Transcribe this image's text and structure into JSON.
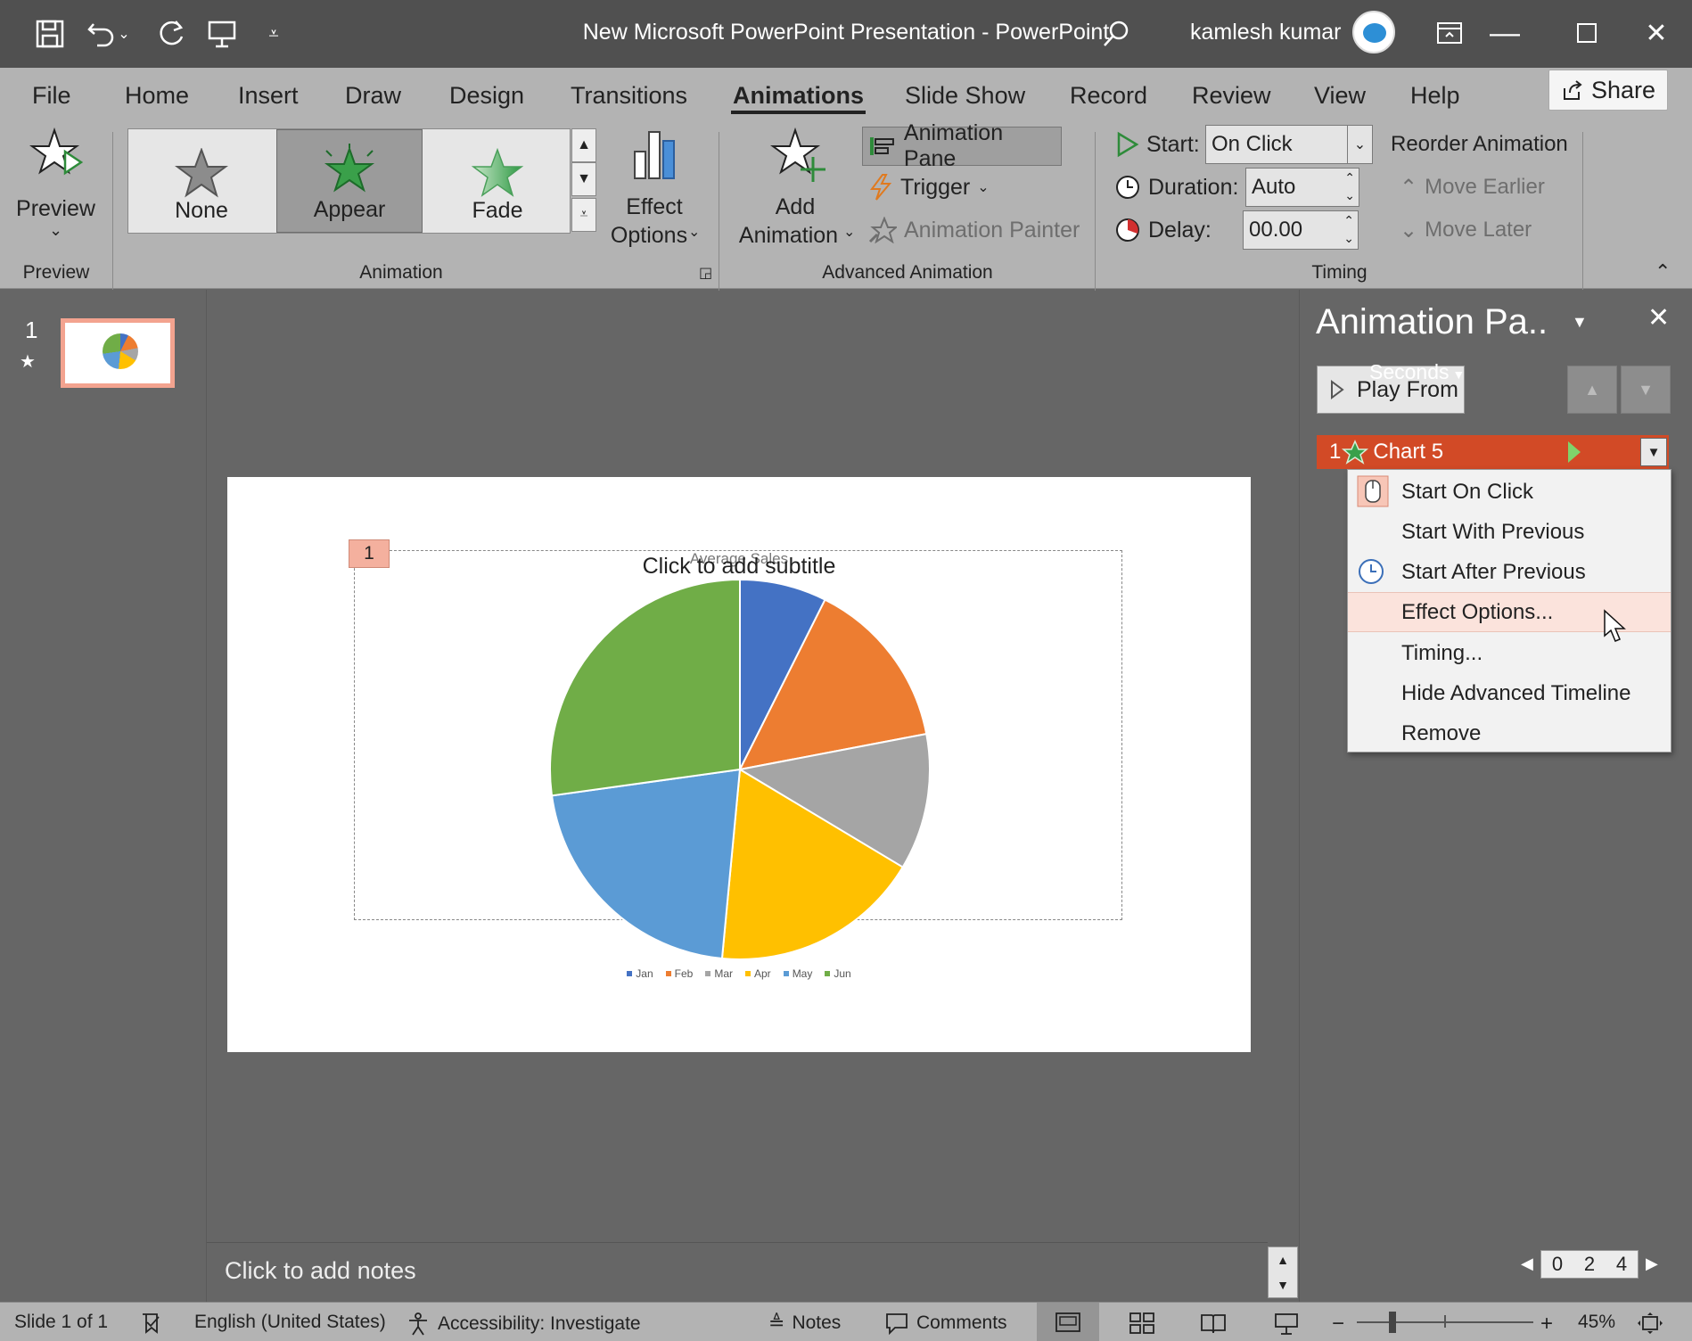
{
  "window": {
    "title": "New Microsoft PowerPoint Presentation  -  PowerPoint",
    "user": "kamlesh kumar"
  },
  "tabs": [
    "File",
    "Home",
    "Insert",
    "Draw",
    "Design",
    "Transitions",
    "Animations",
    "Slide Show",
    "Record",
    "Review",
    "View",
    "Help"
  ],
  "active_tab": "Animations",
  "share_label": "Share",
  "ribbon": {
    "preview": {
      "label": "Preview",
      "group": "Preview"
    },
    "animation_group": "Animation",
    "gallery": [
      "None",
      "Appear",
      "Fade"
    ],
    "gallery_selected": "Appear",
    "effect_options": {
      "line1": "Effect",
      "line2": "Options"
    },
    "advanced": {
      "group": "Advanced Animation",
      "add_line1": "Add",
      "add_line2": "Animation",
      "animation_pane": "Animation Pane",
      "trigger": "Trigger",
      "animation_painter": "Animation Painter"
    },
    "timing": {
      "group": "Timing",
      "start_label": "Start:",
      "start_value": "On Click",
      "duration_label": "Duration:",
      "duration_value": "Auto",
      "delay_label": "Delay:",
      "delay_value": "00.00",
      "reorder": "Reorder Animation",
      "move_earlier": "Move Earlier",
      "move_later": "Move Later"
    }
  },
  "thumbnails": {
    "number": "1"
  },
  "slide": {
    "anim_tag": "1",
    "chart_title": "Average Sales",
    "subtitle_placeholder": "Click to add subtitle"
  },
  "chart_data": {
    "type": "pie",
    "title": "Average Sales",
    "categories": [
      "Jan",
      "Feb",
      "Mar",
      "Apr",
      "May",
      "Jun"
    ],
    "values": [
      7.4,
      14.6,
      11.6,
      17.9,
      21.3,
      27.2
    ],
    "colors": [
      "#4472c4",
      "#ed7d31",
      "#a5a5a5",
      "#ffc000",
      "#5b9bd5",
      "#70ad47"
    ],
    "legend_position": "bottom"
  },
  "notes_placeholder": "Click to add notes",
  "animation_pane": {
    "title": "Animation Pa..",
    "play_from": "Play From",
    "item_index": "1",
    "item_name": "Chart 5",
    "menu": [
      "Start On Click",
      "Start With Previous",
      "Start After Previous",
      "Effect Options...",
      "Timing...",
      "Hide Advanced Timeline",
      "Remove"
    ],
    "highlighted": "Effect Options...",
    "seconds_label": "Seconds",
    "timeline_ticks": [
      "0",
      "2",
      "4"
    ]
  },
  "statusbar": {
    "slide": "Slide 1 of 1",
    "language": "English (United States)",
    "accessibility": "Accessibility: Investigate",
    "notes": "Notes",
    "comments": "Comments",
    "zoom": "45%"
  }
}
